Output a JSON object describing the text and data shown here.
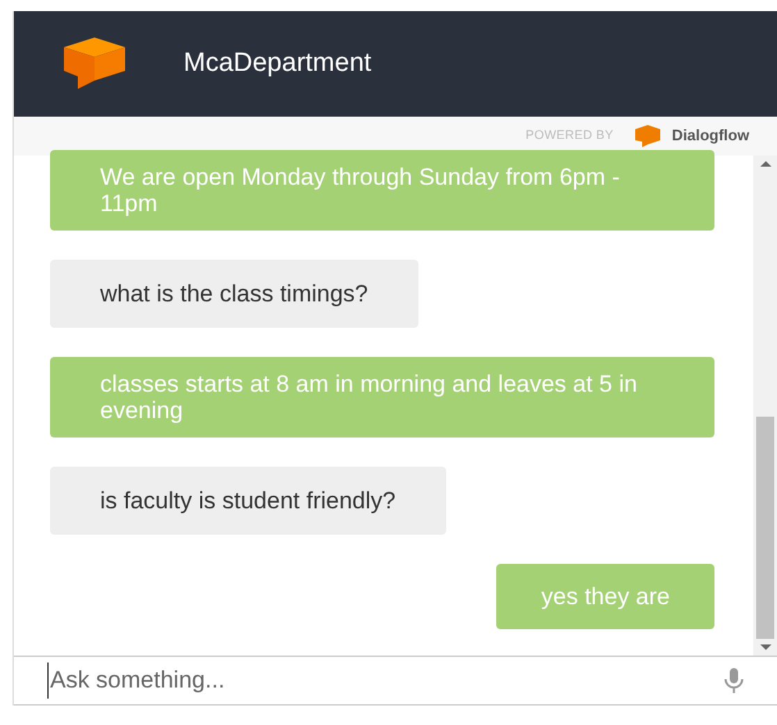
{
  "header": {
    "title": "McaDepartment"
  },
  "powered_by": {
    "label": "POWERED BY",
    "brand": "Dialogflow"
  },
  "messages": [
    {
      "kind": "bot",
      "text": "We are open Monday through Sunday from 6pm - 11pm"
    },
    {
      "kind": "user",
      "text": "what is the class timings?"
    },
    {
      "kind": "bot",
      "text": "classes starts at 8 am in morning and leaves at 5 in evening"
    },
    {
      "kind": "user",
      "text": "is faculty is student friendly?"
    },
    {
      "kind": "bot_short",
      "text": "yes they are"
    }
  ],
  "input": {
    "placeholder": "Ask something..."
  }
}
